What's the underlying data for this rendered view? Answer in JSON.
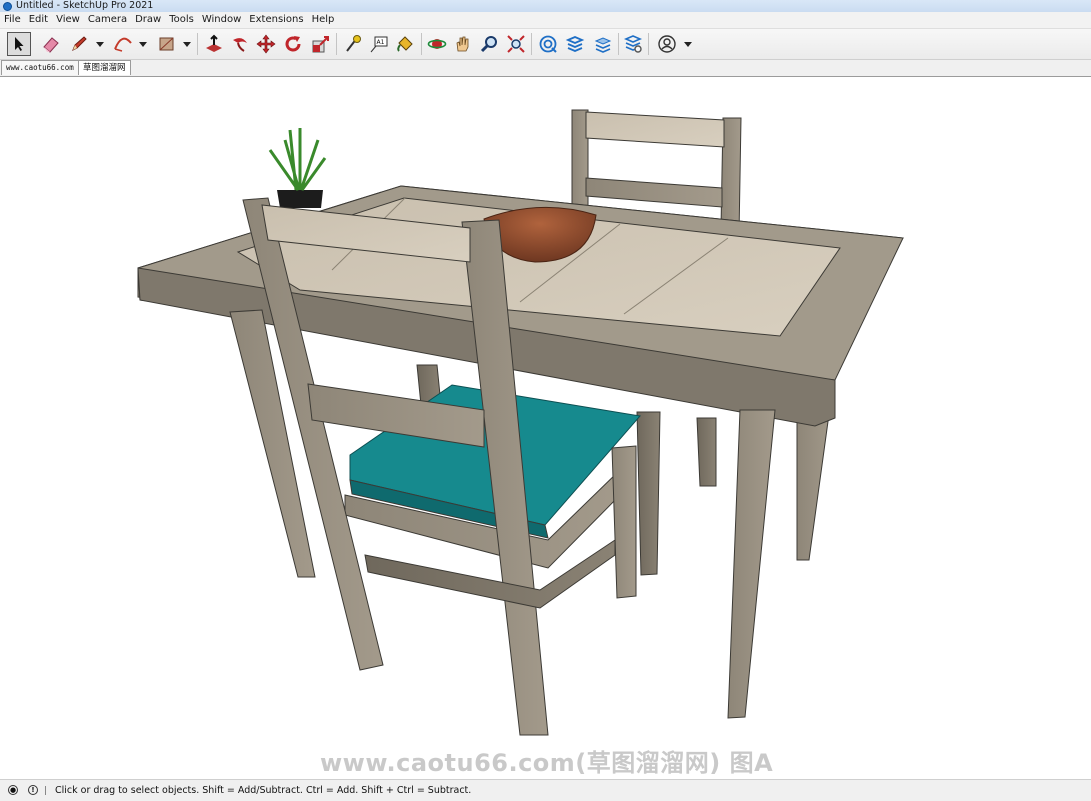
{
  "window": {
    "title": "Untitled - SketchUp Pro 2021"
  },
  "menu": [
    "File",
    "Edit",
    "View",
    "Camera",
    "Draw",
    "Tools",
    "Window",
    "Extensions",
    "Help"
  ],
  "tabs": [
    "www.caotu66.com",
    "草图溜溜网"
  ],
  "viewport": {
    "watermark": "www.caotu66.com(草图溜溜网) 图A"
  },
  "status": {
    "hint": "Click or drag to select objects. Shift = Add/Subtract. Ctrl = Add. Shift + Ctrl = Subtract."
  },
  "colors": {
    "accent": "#1f6fc6",
    "wood": "#8f877b",
    "cushion": "#1a8a8c",
    "bowl": "#8a4a2f"
  },
  "toolbar_icons": [
    "select-icon",
    "eraser-icon",
    "pencil-icon",
    "arc-icon",
    "rectangle-icon",
    "push-pull-icon",
    "follow-me-icon",
    "move-icon",
    "rotate-icon",
    "scale-icon",
    "tape-measure-icon",
    "text-icon",
    "paint-bucket-icon",
    "orbit-icon",
    "pan-icon",
    "zoom-icon",
    "zoom-extents-icon",
    "warehouse-icon",
    "extension-warehouse-icon",
    "layout-icon",
    "extension-manager-icon",
    "account-icon"
  ]
}
